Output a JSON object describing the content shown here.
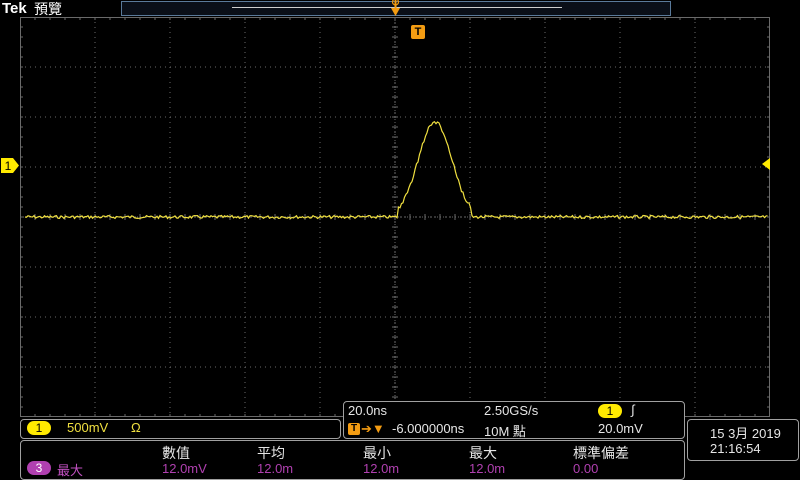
{
  "header": {
    "brand": "Tek",
    "mode": "預覽"
  },
  "channel": {
    "number": "1",
    "scale": "500mV",
    "coupling_symbol": "Ω",
    "color": "#f0e040"
  },
  "horizontal": {
    "timebase": "20.0ns",
    "sample_rate": "2.50GS/s",
    "trigger_source": "1",
    "trigger_slope_symbol": "∫",
    "delay": "-6.000000ns",
    "record_length": "10M 點",
    "trigger_level": "20.0mV",
    "trigger_marker": "T"
  },
  "measurement": {
    "source": "3",
    "label": "最大",
    "headers": [
      "數值",
      "平均",
      "最小",
      "最大",
      "標準偏差"
    ],
    "values": [
      "12.0mV",
      "12.0m",
      "12.0m",
      "12.0m",
      "0.00"
    ],
    "color": "#b040b0"
  },
  "datetime": {
    "date": "15 3月 2019",
    "time": "21:16:54"
  },
  "colors": {
    "trace": "#f0e040",
    "trigger": "#f39c12",
    "grid": "#6a6a6a"
  }
}
